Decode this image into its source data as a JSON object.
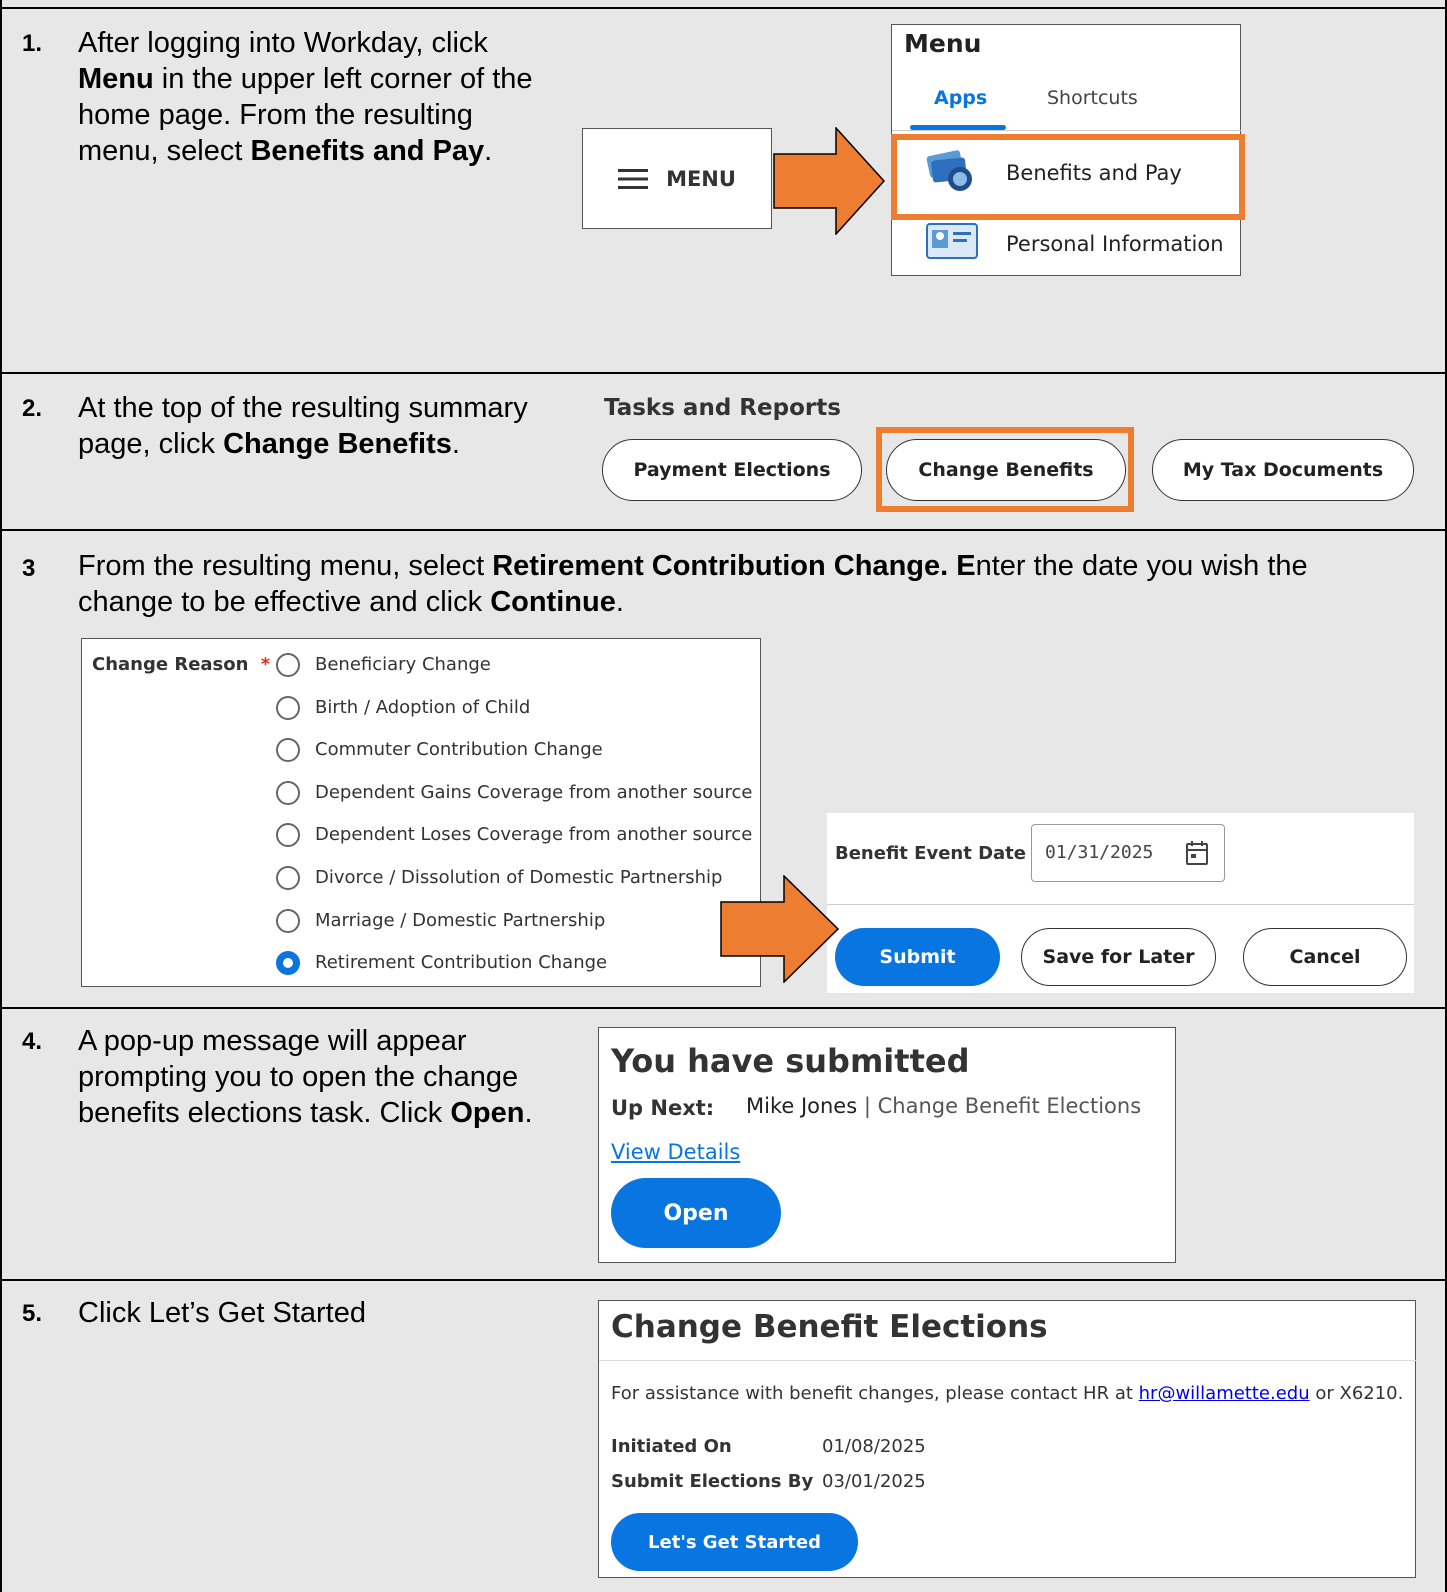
{
  "steps": [
    {
      "number": "1.",
      "parts": [
        {
          "t": "After logging into Workday, click "
        },
        {
          "t": "Menu",
          "b": true
        },
        {
          "t": " in the upper left corner of the home page.  From the resulting menu, select "
        },
        {
          "t": "Benefits and Pay",
          "b": true
        },
        {
          "t": "."
        }
      ]
    },
    {
      "number": "2.",
      "parts": [
        {
          "t": "At the top of the resulting summary page, click "
        },
        {
          "t": "Change Benefits",
          "b": true
        },
        {
          "t": "."
        }
      ]
    },
    {
      "number": "3",
      "parts": [
        {
          "t": "From the resulting menu, select "
        },
        {
          "t": "Retirement Contribution Change. E",
          "b": true
        },
        {
          "t": "nter the date you wish the change to be effective and click "
        },
        {
          "t": "Continue",
          "b": true
        },
        {
          "t": "."
        }
      ]
    },
    {
      "number": "4.",
      "parts": [
        {
          "t": "A pop-up message will appear prompting you to open the change benefits elections task.  Click "
        },
        {
          "t": "Open",
          "b": true
        },
        {
          "t": "."
        }
      ]
    },
    {
      "number": "5.",
      "parts": [
        {
          "t": "Click Let’s Get Started"
        }
      ]
    }
  ],
  "menu_button": {
    "label": "MENU"
  },
  "menu_panel": {
    "title": "Menu",
    "tabs": [
      "Apps",
      "Shortcuts"
    ],
    "items": [
      {
        "label": "Benefits and Pay",
        "icon": "money-icon"
      },
      {
        "label": "Personal Information",
        "icon": "id-card-icon"
      }
    ]
  },
  "tasks": {
    "heading": "Tasks and Reports",
    "buttons": [
      "Payment Elections",
      "Change Benefits",
      "My Tax Documents"
    ]
  },
  "change_reason": {
    "label": "Change Reason",
    "required_mark": "*",
    "options": [
      "Beneficiary Change",
      "Birth / Adoption of Child",
      "Commuter Contribution Change",
      "Dependent Gains Coverage from another source",
      "Dependent Loses Coverage from another source",
      "Divorce / Dissolution of Domestic Partnership",
      "Marriage / Domestic Partnership",
      "Retirement Contribution Change"
    ],
    "selected": "Retirement Contribution Change"
  },
  "event_date": {
    "label": "Benefit Event Date",
    "required_mark": "*",
    "value": "01/31/2025",
    "buttons": {
      "submit": "Submit",
      "save": "Save for Later",
      "cancel": "Cancel"
    }
  },
  "popup": {
    "title": "You have submitted",
    "up_next_label": "Up Next:",
    "up_next_person": "Mike Jones",
    "separator": "|",
    "up_next_task": "Change Benefit Elections",
    "link": "View Details",
    "open_button": "Open"
  },
  "elections": {
    "title": "Change Benefit Elections",
    "assist_prefix": "For assistance with benefit changes, please contact HR at ",
    "email": "hr@willamette.edu",
    "assist_suffix": " or X6210.",
    "fields": [
      {
        "label": "Initiated On",
        "value": "01/08/2025"
      },
      {
        "label": "Submit Elections By",
        "value": "03/01/2025"
      }
    ],
    "button": "Let's Get Started"
  },
  "colors": {
    "accent_orange": "#ed7d31",
    "workday_blue": "#0875e1",
    "row_bg": "#e7e7e7"
  }
}
